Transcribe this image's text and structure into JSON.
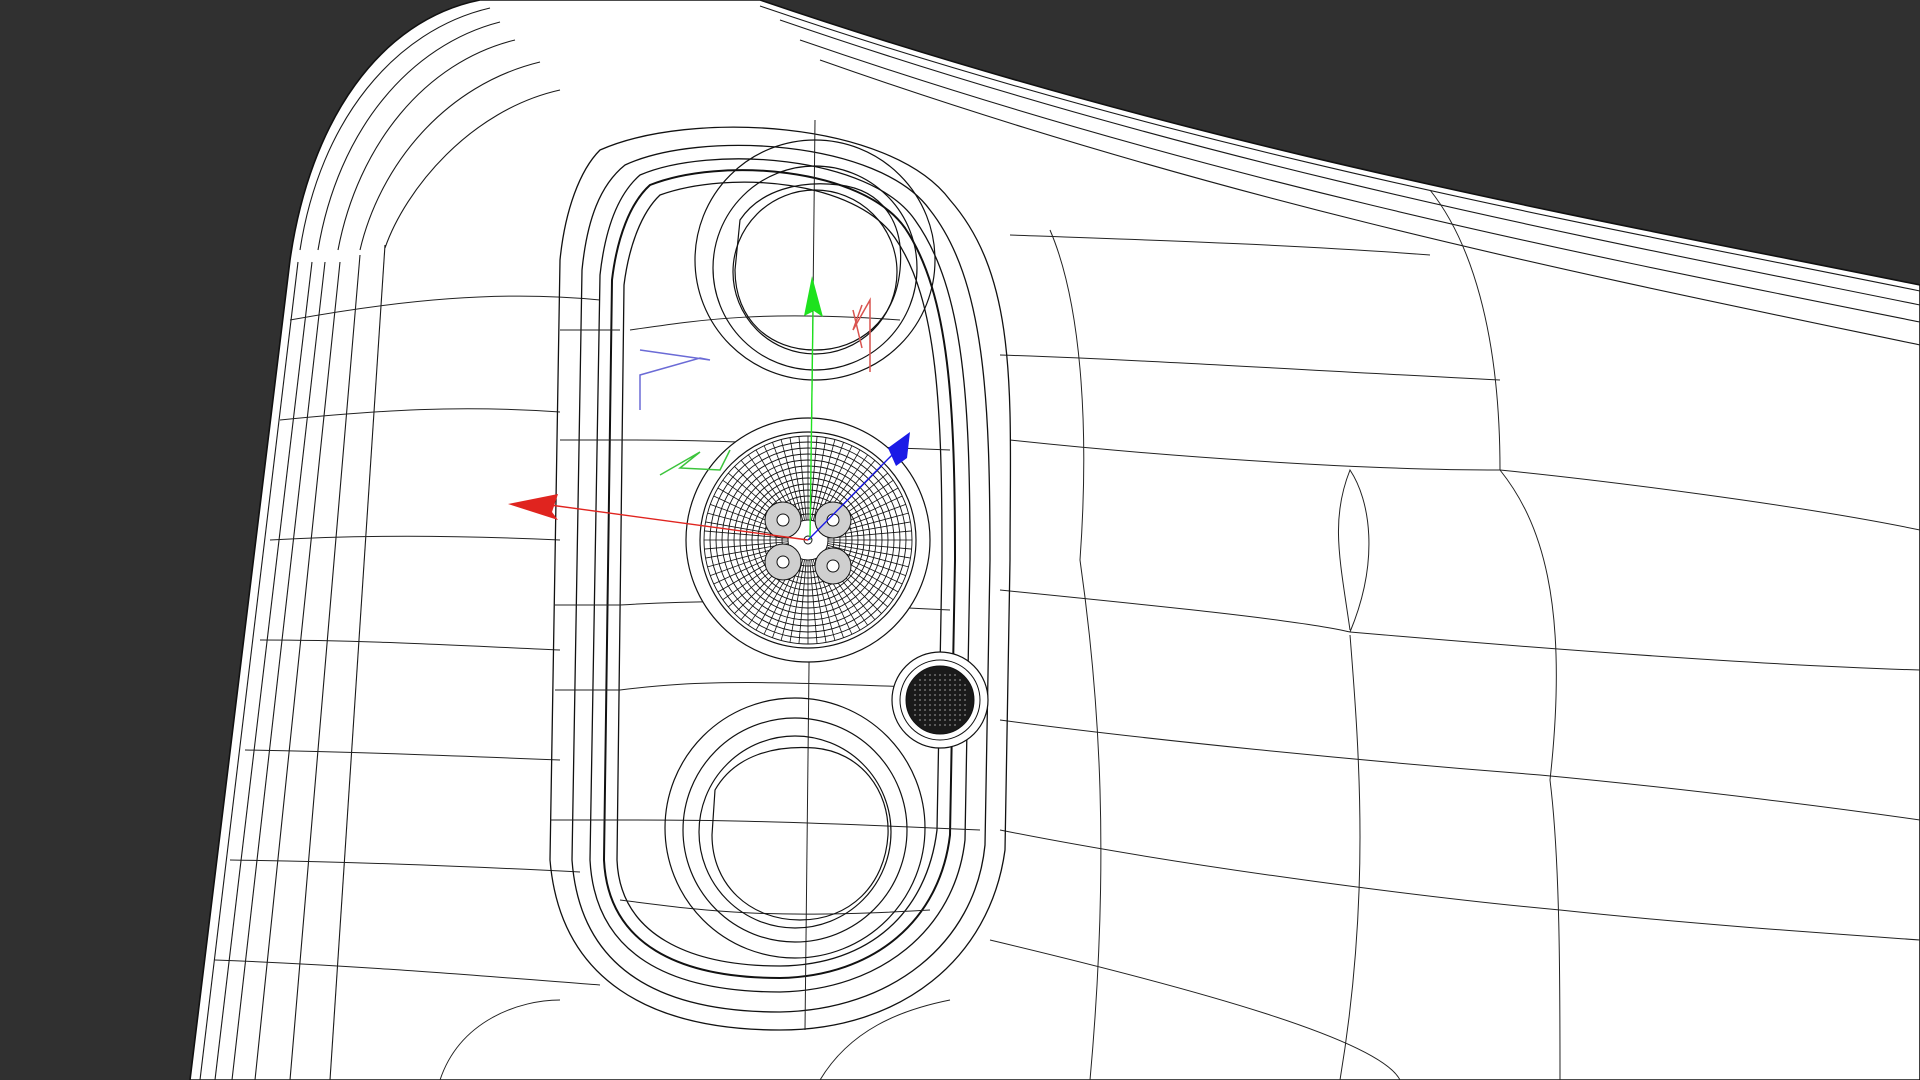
{
  "viewport": {
    "mode": "wireframe",
    "background_color": "#303030",
    "mesh_fill_color": "#ffffff",
    "wire_color": "#111111"
  },
  "object": {
    "name": "",
    "kind": "phone-rear-camera-bump"
  },
  "gizmo": {
    "type": "move-gizmo",
    "axes": [
      {
        "axis": "x",
        "color": "#e0241f",
        "icon": "x-axis-arrow-icon"
      },
      {
        "axis": "y",
        "color": "#1ee21e",
        "icon": "y-axis-arrow-icon"
      },
      {
        "axis": "z",
        "color": "#1a1ae6",
        "icon": "z-axis-arrow-icon"
      }
    ],
    "plane_handles": [
      {
        "plane": "xy",
        "color": "#d9534f"
      },
      {
        "plane": "yz",
        "color": "#6b6bd6"
      },
      {
        "plane": "xz",
        "color": "#3cc43c"
      }
    ]
  },
  "camera_elements": [
    {
      "name": "top-lens",
      "icon": "lens-icon"
    },
    {
      "name": "middle-lens",
      "icon": "lens-icon"
    },
    {
      "name": "bottom-lens",
      "icon": "lens-icon"
    },
    {
      "name": "flash",
      "icon": "flash-icon"
    }
  ]
}
